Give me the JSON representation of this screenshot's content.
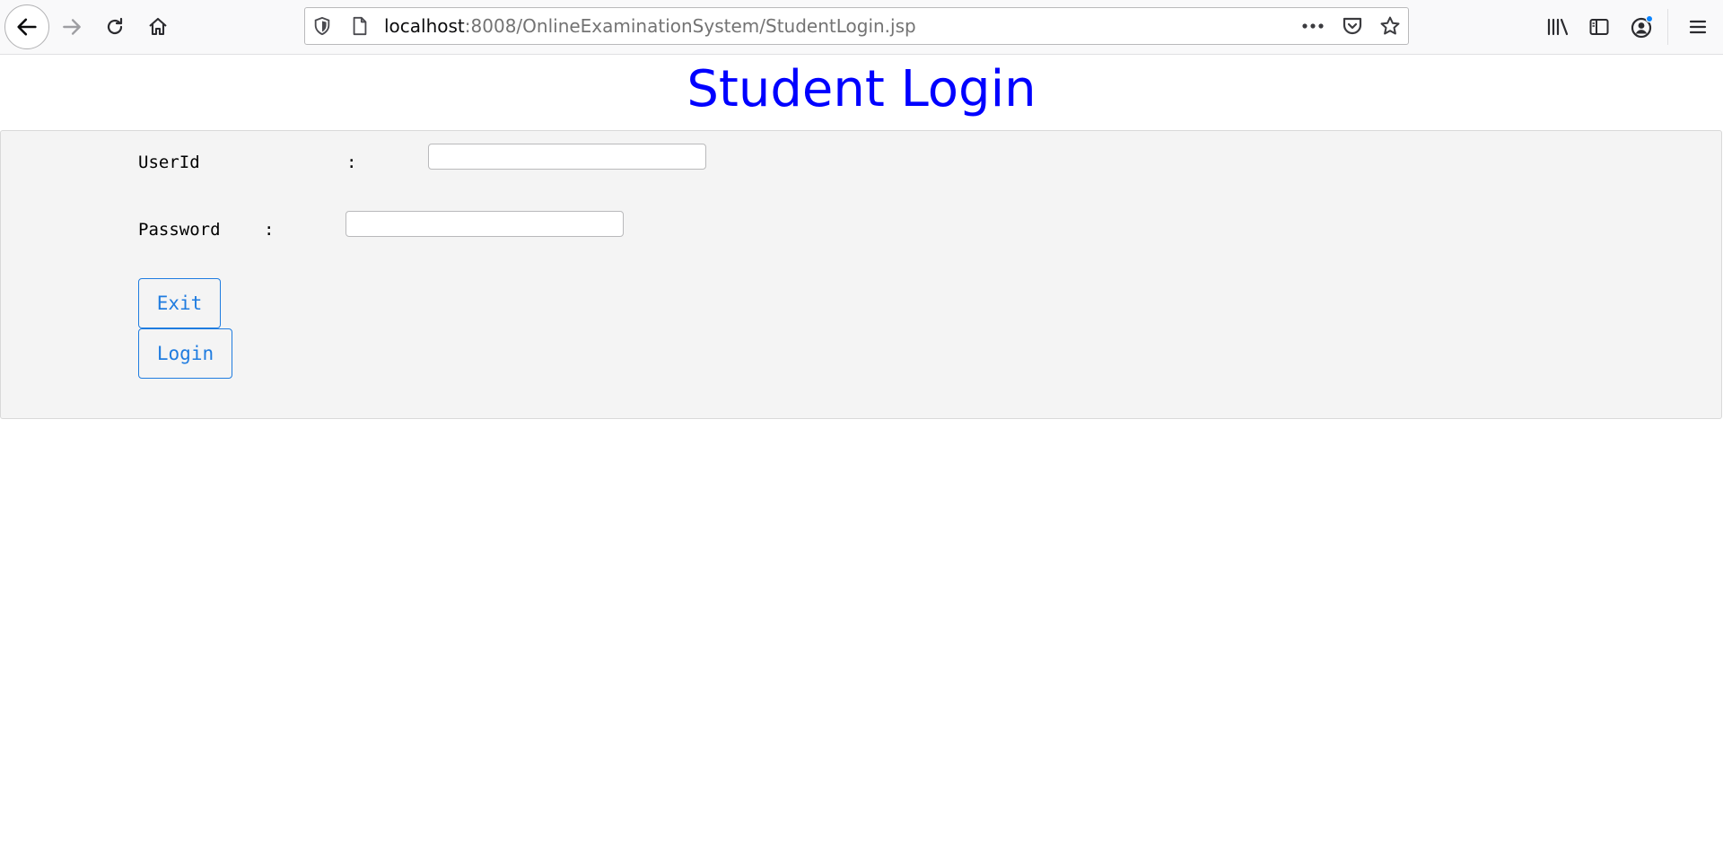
{
  "browser": {
    "url_host": "localhost",
    "url_rest": ":8008/OnlineExaminationSystem/StudentLogin.jsp",
    "notification_dot_color": "#0a84ff",
    "icons": {
      "back": "back-arrow-icon",
      "forward": "forward-arrow-icon",
      "reload": "reload-icon",
      "home": "home-icon",
      "shield": "shield-icon",
      "page": "page-icon",
      "more": "more-icon",
      "pocket": "pocket-icon",
      "bookmark": "star-icon",
      "library": "library-icon",
      "sidebar": "sidebar-icon",
      "account": "account-icon",
      "menu": "hamburger-menu-icon"
    }
  },
  "page": {
    "title": "Student Login",
    "title_color": "#0000ff",
    "form": {
      "userid_label": "UserId",
      "userid_colon": ":",
      "userid_value": "",
      "password_label": "Password",
      "password_colon": ":",
      "password_value": "",
      "exit_label": "Exit",
      "login_label": "Login",
      "button_color": "#1f7ce0",
      "panel_color": "#f4f4f4"
    }
  }
}
